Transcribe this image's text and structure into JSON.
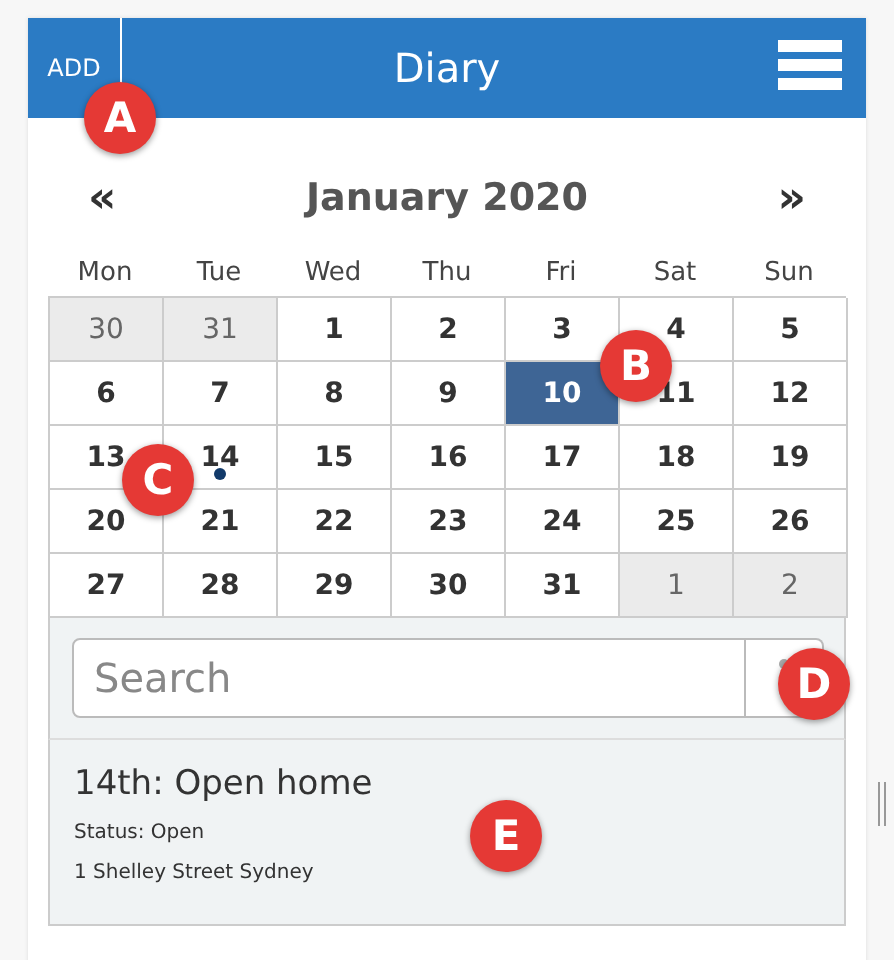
{
  "header": {
    "add_label": "ADD",
    "title": "Diary"
  },
  "calendar": {
    "prev": "«",
    "month": "January 2020",
    "next": "»",
    "weekdays": [
      "Mon",
      "Tue",
      "Wed",
      "Thu",
      "Fri",
      "Sat",
      "Sun"
    ],
    "days": [
      {
        "label": "30",
        "in_month": false,
        "selected": false,
        "has_event": false
      },
      {
        "label": "31",
        "in_month": false,
        "selected": false,
        "has_event": false
      },
      {
        "label": "1",
        "in_month": true,
        "selected": false,
        "has_event": false
      },
      {
        "label": "2",
        "in_month": true,
        "selected": false,
        "has_event": false
      },
      {
        "label": "3",
        "in_month": true,
        "selected": false,
        "has_event": false
      },
      {
        "label": "4",
        "in_month": true,
        "selected": false,
        "has_event": false
      },
      {
        "label": "5",
        "in_month": true,
        "selected": false,
        "has_event": false
      },
      {
        "label": "6",
        "in_month": true,
        "selected": false,
        "has_event": false
      },
      {
        "label": "7",
        "in_month": true,
        "selected": false,
        "has_event": false
      },
      {
        "label": "8",
        "in_month": true,
        "selected": false,
        "has_event": false
      },
      {
        "label": "9",
        "in_month": true,
        "selected": false,
        "has_event": false
      },
      {
        "label": "10",
        "in_month": true,
        "selected": true,
        "has_event": false
      },
      {
        "label": "11",
        "in_month": true,
        "selected": false,
        "has_event": false
      },
      {
        "label": "12",
        "in_month": true,
        "selected": false,
        "has_event": false
      },
      {
        "label": "13",
        "in_month": true,
        "selected": false,
        "has_event": false
      },
      {
        "label": "14",
        "in_month": true,
        "selected": false,
        "has_event": true
      },
      {
        "label": "15",
        "in_month": true,
        "selected": false,
        "has_event": false
      },
      {
        "label": "16",
        "in_month": true,
        "selected": false,
        "has_event": false
      },
      {
        "label": "17",
        "in_month": true,
        "selected": false,
        "has_event": false
      },
      {
        "label": "18",
        "in_month": true,
        "selected": false,
        "has_event": false
      },
      {
        "label": "19",
        "in_month": true,
        "selected": false,
        "has_event": false
      },
      {
        "label": "20",
        "in_month": true,
        "selected": false,
        "has_event": false
      },
      {
        "label": "21",
        "in_month": true,
        "selected": false,
        "has_event": false
      },
      {
        "label": "22",
        "in_month": true,
        "selected": false,
        "has_event": false
      },
      {
        "label": "23",
        "in_month": true,
        "selected": false,
        "has_event": false
      },
      {
        "label": "24",
        "in_month": true,
        "selected": false,
        "has_event": false
      },
      {
        "label": "25",
        "in_month": true,
        "selected": false,
        "has_event": false
      },
      {
        "label": "26",
        "in_month": true,
        "selected": false,
        "has_event": false
      },
      {
        "label": "27",
        "in_month": true,
        "selected": false,
        "has_event": false
      },
      {
        "label": "28",
        "in_month": true,
        "selected": false,
        "has_event": false
      },
      {
        "label": "29",
        "in_month": true,
        "selected": false,
        "has_event": false
      },
      {
        "label": "30",
        "in_month": true,
        "selected": false,
        "has_event": false
      },
      {
        "label": "31",
        "in_month": true,
        "selected": false,
        "has_event": false
      },
      {
        "label": "1",
        "in_month": false,
        "selected": false,
        "has_event": false
      },
      {
        "label": "2",
        "in_month": false,
        "selected": false,
        "has_event": false
      }
    ]
  },
  "search": {
    "placeholder": "Search"
  },
  "event": {
    "title": "14th: Open home",
    "status": "Status: Open",
    "address": "1 Shelley Street Sydney"
  },
  "callouts": [
    "A",
    "B",
    "C",
    "D",
    "E"
  ]
}
